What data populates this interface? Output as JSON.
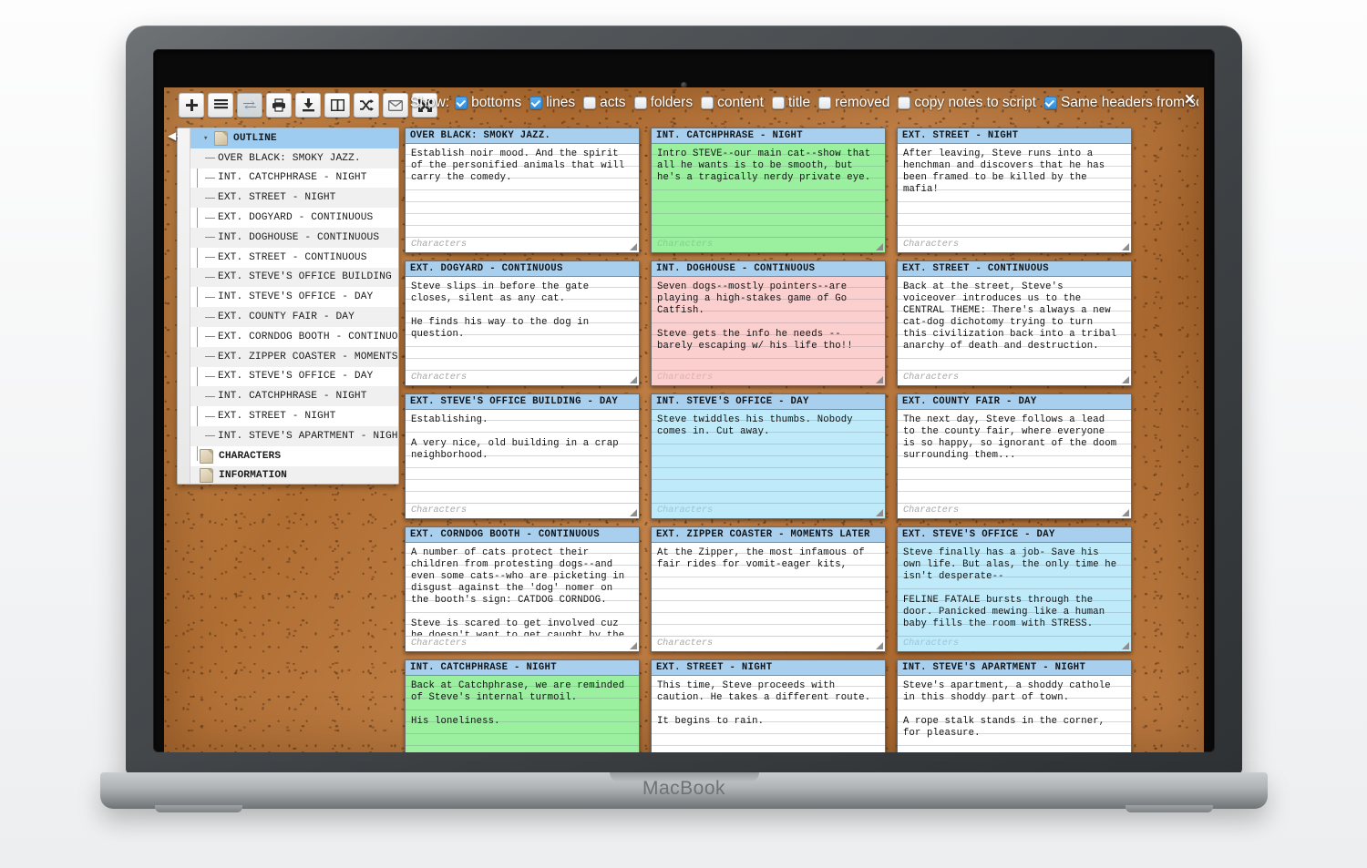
{
  "device": {
    "brand_label": "MacBook"
  },
  "app": {
    "close_label": "×",
    "collapse_label": "◀◀",
    "toolbar_icons": [
      {
        "name": "add-card-icon",
        "glyph": "plus"
      },
      {
        "name": "list-view-icon",
        "glyph": "lines"
      },
      {
        "name": "swap-order-icon",
        "glyph": "swap",
        "active": true
      },
      {
        "name": "print-icon",
        "glyph": "printer"
      },
      {
        "name": "import-icon",
        "glyph": "download"
      },
      {
        "name": "split-view-icon",
        "glyph": "columns"
      },
      {
        "name": "shuffle-icon",
        "glyph": "shuffle"
      },
      {
        "name": "email-icon",
        "glyph": "envelope"
      },
      {
        "name": "fullscreen-icon",
        "glyph": "expand"
      }
    ],
    "show": {
      "label": "Show:",
      "options": [
        {
          "label": "bottoms",
          "checked": true
        },
        {
          "label": "lines",
          "checked": true
        },
        {
          "label": "acts",
          "checked": false
        },
        {
          "label": "folders",
          "checked": false
        },
        {
          "label": "content",
          "checked": false
        },
        {
          "label": "title",
          "checked": false
        },
        {
          "label": "removed",
          "checked": false
        },
        {
          "label": "copy notes to script",
          "checked": false
        }
      ],
      "same_headers": {
        "label": "Same headers from scri",
        "checked": true
      }
    }
  },
  "sidebar": {
    "nodes": [
      {
        "label": "OUTLINE",
        "type": "root",
        "selected": true
      },
      {
        "label": "OVER BLACK: SMOKY JAZZ.",
        "type": "leaf"
      },
      {
        "label": "INT. CATCHPHRASE - NIGHT",
        "type": "leaf"
      },
      {
        "label": "EXT. STREET - NIGHT",
        "type": "leaf"
      },
      {
        "label": "EXT. DOGYARD - CONTINUOUS",
        "type": "leaf"
      },
      {
        "label": "INT. DOGHOUSE - CONTINUOUS",
        "type": "leaf"
      },
      {
        "label": "EXT. STREET - CONTINUOUS",
        "type": "leaf"
      },
      {
        "label": "EXT. STEVE'S OFFICE BUILDING - DAY",
        "type": "leaf"
      },
      {
        "label": "INT. STEVE'S OFFICE - DAY",
        "type": "leaf"
      },
      {
        "label": "EXT. COUNTY FAIR - DAY",
        "type": "leaf"
      },
      {
        "label": "EXT. CORNDOG BOOTH - CONTINUOUS",
        "type": "leaf"
      },
      {
        "label": "EXT. ZIPPER COASTER - MOMENTS",
        "type": "leaf"
      },
      {
        "label": "EXT. STEVE'S OFFICE - DAY",
        "type": "leaf"
      },
      {
        "label": "INT. CATCHPHRASE - NIGHT",
        "type": "leaf"
      },
      {
        "label": "EXT. STREET - NIGHT",
        "type": "leaf"
      },
      {
        "label": "INT. STEVE'S APARTMENT - NIGHT",
        "type": "leaf"
      },
      {
        "label": "CHARACTERS",
        "type": "folder"
      },
      {
        "label": "INFORMATION",
        "type": "folder"
      }
    ]
  },
  "board": {
    "characters_placeholder": "Characters",
    "cards": [
      {
        "title": "OVER BLACK: SMOKY JAZZ.",
        "color": "white",
        "body": "Establish noir mood. And the spirit\nof the personified animals that will\ncarry the comedy."
      },
      {
        "title": "INT. CATCHPHRASE - NIGHT",
        "color": "green",
        "body": "Intro STEVE--our main cat--show that\nall he wants is to be smooth, but\nhe's a tragically nerdy private eye."
      },
      {
        "title": "EXT. STREET - NIGHT",
        "color": "white",
        "body": "After leaving, Steve runs into a\nhenchman and discovers that he has\nbeen framed to be killed by the\nmafia!"
      },
      {
        "title": "EXT. DOGYARD - CONTINUOUS",
        "color": "white",
        "body": "Steve slips in before the gate\ncloses, silent as any cat.\n\nHe finds his way to the dog in\nquestion."
      },
      {
        "title": "INT. DOGHOUSE - CONTINUOUS",
        "color": "pink",
        "body": "Seven dogs--mostly pointers--are\nplaying a high-stakes game of Go\nCatfish.\n\nSteve gets the info he needs --\nbarely escaping w/ his life tho!!"
      },
      {
        "title": "EXT. STREET - CONTINUOUS",
        "color": "white",
        "body": "Back at the street, Steve's\nvoiceover introduces us to the\nCENTRAL THEME: There's always a new\ncat-dog dichotomy trying to turn\nthis civilization back into a tribal\nanarchy of death and destruction."
      },
      {
        "title": "EXT. STEVE'S OFFICE BUILDING - DAY",
        "color": "white",
        "body": "Establishing.\n\nA very nice, old building in a crap\nneighborhood."
      },
      {
        "title": "INT. STEVE'S OFFICE - DAY",
        "color": "blue",
        "body": "Steve twiddles his thumbs. Nobody\ncomes in. Cut away."
      },
      {
        "title": "EXT. COUNTY FAIR - DAY",
        "color": "white",
        "body": "The next day, Steve follows a lead\nto the county fair, where everyone\nis so happy, so ignorant of the doom\nsurrounding them..."
      },
      {
        "title": "EXT. CORNDOG BOOTH - CONTINUOUS",
        "color": "white",
        "body": "A number of cats protect their\nchildren from protesting dogs--and\neven some cats--who are picketing in\ndisgust against the 'dog' nomer on\nthe booth's sign: CATDOG CORNDOG.\n\nSteve is scared to get involved cuz\nhe doesn't want to get caught by the"
      },
      {
        "title": "EXT. ZIPPER COASTER - MOMENTS LATER",
        "color": "white",
        "body": "At the Zipper, the most infamous of\nfair rides for vomit-eager kits,"
      },
      {
        "title": "EXT. STEVE'S OFFICE - DAY",
        "color": "blue",
        "body": "Steve finally has a job- Save his\nown life. But alas, the only time he\nisn't desperate--\n\nFELINE FATALE bursts through the\ndoor. Panicked mewing like a human\nbaby fills the room with STRESS."
      },
      {
        "title": "INT. CATCHPHRASE - NIGHT",
        "color": "green",
        "body": "Back at Catchphrase, we are reminded\nof Steve's internal turmoil.\n\nHis loneliness."
      },
      {
        "title": "EXT. STREET - NIGHT",
        "color": "white",
        "body": "This time, Steve proceeds with\ncaution. He takes a different route.\n\nIt begins to rain."
      },
      {
        "title": "INT. STEVE'S APARTMENT - NIGHT",
        "color": "white",
        "body": "Steve's apartment, a shoddy cathole\nin this shoddy part of town.\n\nA rope stalk stands in the corner,\nfor pleasure."
      }
    ]
  }
}
